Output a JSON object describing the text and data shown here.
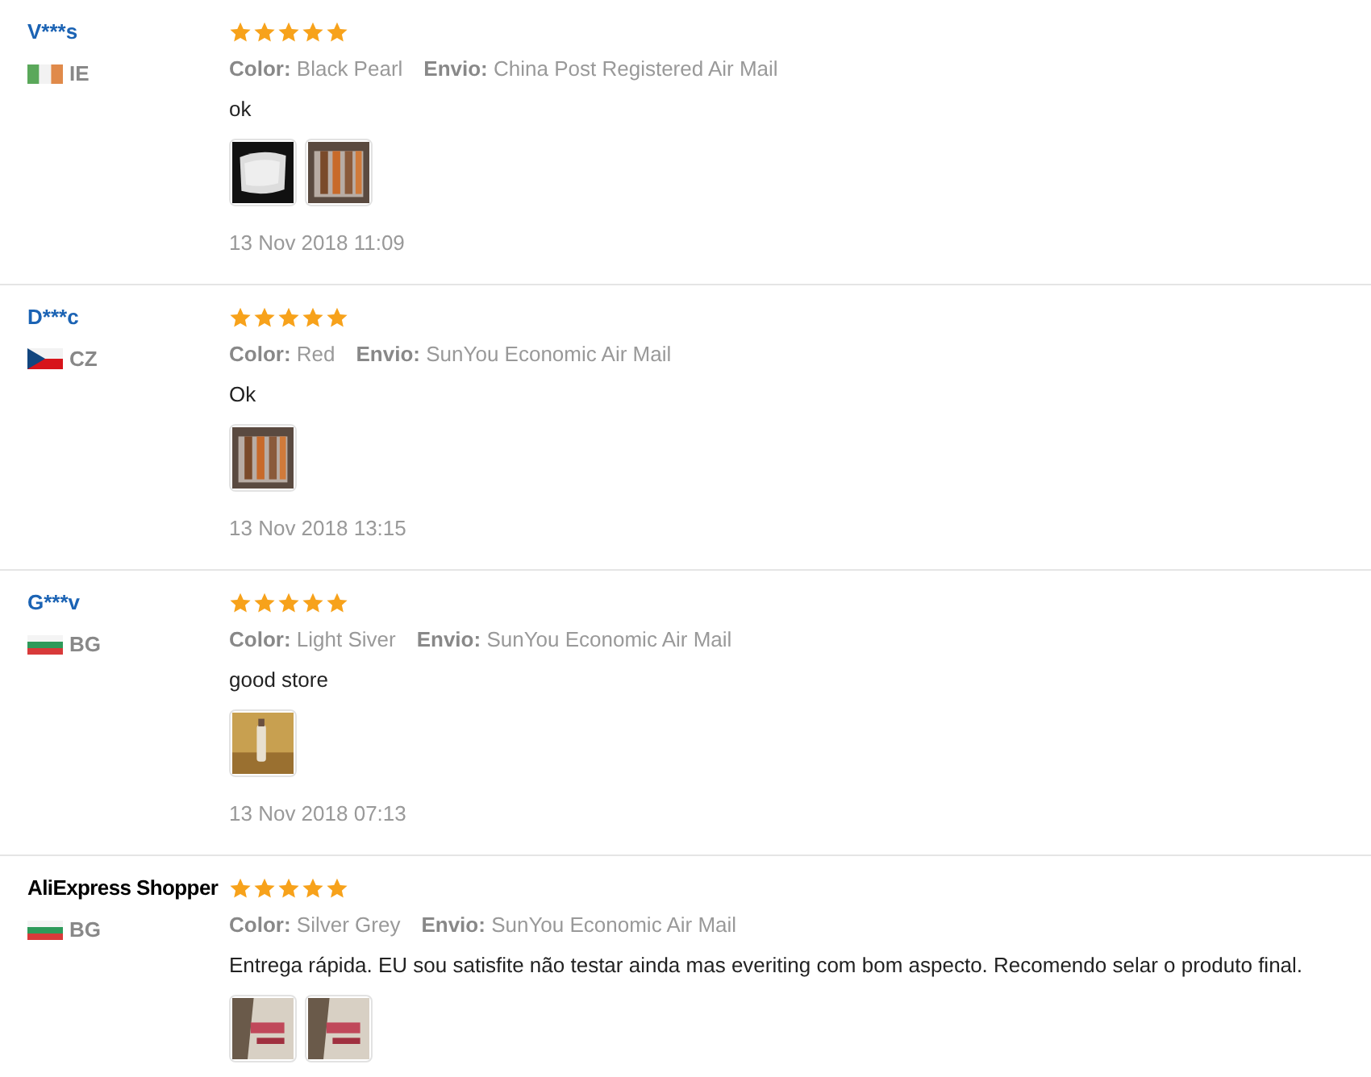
{
  "reviews": [
    {
      "name": "V***s",
      "kind": "masked",
      "flag": {
        "kind": "ireland"
      },
      "country": "IE",
      "stars": 5,
      "color_label": "Color:",
      "color_value": "Black Pearl",
      "shipping_label": "Envio:",
      "shipping": "China Post Registered Air Mail",
      "text": "ok",
      "photos": [
        {
          "kind": "picture"
        },
        {
          "kind": "picture"
        }
      ],
      "date": "13 Nov 2018 11:09"
    },
    {
      "name": "D***c",
      "kind": "masked",
      "flag": {
        "kind": "czechia"
      },
      "country": "CZ",
      "stars": 5,
      "color_label": "Color:",
      "color_value": "Red",
      "shipping_label": "Envio:",
      "shipping": "SunYou Economic Air Mail",
      "text": "Ok",
      "photos": [
        {
          "kind": "picture"
        }
      ],
      "date": "13 Nov 2018 13:15"
    },
    {
      "name": "G***v",
      "kind": "masked",
      "flag": {
        "kind": "bulgaria"
      },
      "country": "BG",
      "stars": 5,
      "color_label": "Color:",
      "color_value": "Light Siver",
      "shipping_label": "Envio:",
      "shipping": "SunYou Economic Air Mail",
      "text": "good store",
      "photos": [
        {
          "kind": "picture"
        }
      ],
      "date": "13 Nov 2018 07:13"
    },
    {
      "name": "AliExpress Shopper",
      "kind": "shopper",
      "flag": {
        "kind": "bulgaria"
      },
      "country": "BG",
      "stars": 5,
      "color_label": "Color:",
      "color_value": "Silver Grey",
      "shipping_label": "Envio:",
      "shipping": "SunYou Economic Air Mail",
      "text": "Entrega rápida. EU sou satisfite não testar ainda mas everiting com bom aspecto. Recomendo selar o produto final.",
      "photos": [
        {
          "kind": "picture"
        },
        {
          "kind": "picture"
        }
      ]
    }
  ]
}
